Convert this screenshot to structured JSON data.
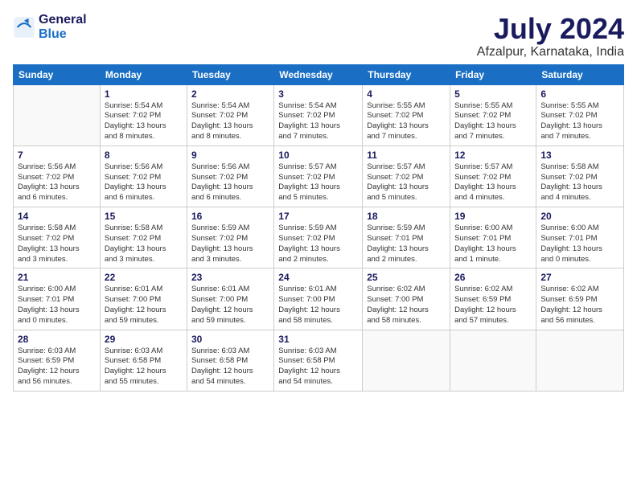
{
  "app": {
    "logo_line1": "General",
    "logo_line2": "Blue"
  },
  "header": {
    "month_year": "July 2024",
    "location": "Afzalpur, Karnataka, India"
  },
  "weekdays": [
    "Sunday",
    "Monday",
    "Tuesday",
    "Wednesday",
    "Thursday",
    "Friday",
    "Saturday"
  ],
  "weeks": [
    [
      {
        "day": "",
        "info": ""
      },
      {
        "day": "1",
        "info": "Sunrise: 5:54 AM\nSunset: 7:02 PM\nDaylight: 13 hours\nand 8 minutes."
      },
      {
        "day": "2",
        "info": "Sunrise: 5:54 AM\nSunset: 7:02 PM\nDaylight: 13 hours\nand 8 minutes."
      },
      {
        "day": "3",
        "info": "Sunrise: 5:54 AM\nSunset: 7:02 PM\nDaylight: 13 hours\nand 7 minutes."
      },
      {
        "day": "4",
        "info": "Sunrise: 5:55 AM\nSunset: 7:02 PM\nDaylight: 13 hours\nand 7 minutes."
      },
      {
        "day": "5",
        "info": "Sunrise: 5:55 AM\nSunset: 7:02 PM\nDaylight: 13 hours\nand 7 minutes."
      },
      {
        "day": "6",
        "info": "Sunrise: 5:55 AM\nSunset: 7:02 PM\nDaylight: 13 hours\nand 7 minutes."
      }
    ],
    [
      {
        "day": "7",
        "info": "Sunrise: 5:56 AM\nSunset: 7:02 PM\nDaylight: 13 hours\nand 6 minutes."
      },
      {
        "day": "8",
        "info": "Sunrise: 5:56 AM\nSunset: 7:02 PM\nDaylight: 13 hours\nand 6 minutes."
      },
      {
        "day": "9",
        "info": "Sunrise: 5:56 AM\nSunset: 7:02 PM\nDaylight: 13 hours\nand 6 minutes."
      },
      {
        "day": "10",
        "info": "Sunrise: 5:57 AM\nSunset: 7:02 PM\nDaylight: 13 hours\nand 5 minutes."
      },
      {
        "day": "11",
        "info": "Sunrise: 5:57 AM\nSunset: 7:02 PM\nDaylight: 13 hours\nand 5 minutes."
      },
      {
        "day": "12",
        "info": "Sunrise: 5:57 AM\nSunset: 7:02 PM\nDaylight: 13 hours\nand 4 minutes."
      },
      {
        "day": "13",
        "info": "Sunrise: 5:58 AM\nSunset: 7:02 PM\nDaylight: 13 hours\nand 4 minutes."
      }
    ],
    [
      {
        "day": "14",
        "info": "Sunrise: 5:58 AM\nSunset: 7:02 PM\nDaylight: 13 hours\nand 3 minutes."
      },
      {
        "day": "15",
        "info": "Sunrise: 5:58 AM\nSunset: 7:02 PM\nDaylight: 13 hours\nand 3 minutes."
      },
      {
        "day": "16",
        "info": "Sunrise: 5:59 AM\nSunset: 7:02 PM\nDaylight: 13 hours\nand 3 minutes."
      },
      {
        "day": "17",
        "info": "Sunrise: 5:59 AM\nSunset: 7:02 PM\nDaylight: 13 hours\nand 2 minutes."
      },
      {
        "day": "18",
        "info": "Sunrise: 5:59 AM\nSunset: 7:01 PM\nDaylight: 13 hours\nand 2 minutes."
      },
      {
        "day": "19",
        "info": "Sunrise: 6:00 AM\nSunset: 7:01 PM\nDaylight: 13 hours\nand 1 minute."
      },
      {
        "day": "20",
        "info": "Sunrise: 6:00 AM\nSunset: 7:01 PM\nDaylight: 13 hours\nand 0 minutes."
      }
    ],
    [
      {
        "day": "21",
        "info": "Sunrise: 6:00 AM\nSunset: 7:01 PM\nDaylight: 13 hours\nand 0 minutes."
      },
      {
        "day": "22",
        "info": "Sunrise: 6:01 AM\nSunset: 7:00 PM\nDaylight: 12 hours\nand 59 minutes."
      },
      {
        "day": "23",
        "info": "Sunrise: 6:01 AM\nSunset: 7:00 PM\nDaylight: 12 hours\nand 59 minutes."
      },
      {
        "day": "24",
        "info": "Sunrise: 6:01 AM\nSunset: 7:00 PM\nDaylight: 12 hours\nand 58 minutes."
      },
      {
        "day": "25",
        "info": "Sunrise: 6:02 AM\nSunset: 7:00 PM\nDaylight: 12 hours\nand 58 minutes."
      },
      {
        "day": "26",
        "info": "Sunrise: 6:02 AM\nSunset: 6:59 PM\nDaylight: 12 hours\nand 57 minutes."
      },
      {
        "day": "27",
        "info": "Sunrise: 6:02 AM\nSunset: 6:59 PM\nDaylight: 12 hours\nand 56 minutes."
      }
    ],
    [
      {
        "day": "28",
        "info": "Sunrise: 6:03 AM\nSunset: 6:59 PM\nDaylight: 12 hours\nand 56 minutes."
      },
      {
        "day": "29",
        "info": "Sunrise: 6:03 AM\nSunset: 6:58 PM\nDaylight: 12 hours\nand 55 minutes."
      },
      {
        "day": "30",
        "info": "Sunrise: 6:03 AM\nSunset: 6:58 PM\nDaylight: 12 hours\nand 54 minutes."
      },
      {
        "day": "31",
        "info": "Sunrise: 6:03 AM\nSunset: 6:58 PM\nDaylight: 12 hours\nand 54 minutes."
      },
      {
        "day": "",
        "info": ""
      },
      {
        "day": "",
        "info": ""
      },
      {
        "day": "",
        "info": ""
      }
    ]
  ]
}
